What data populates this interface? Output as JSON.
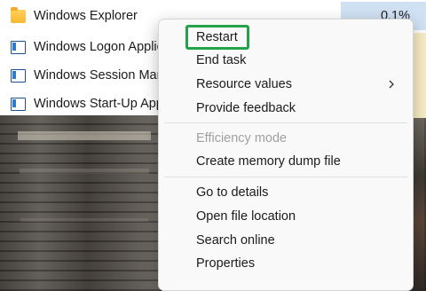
{
  "processes": [
    {
      "name": "Windows Explorer",
      "icon": "folder-icon",
      "cpu": "0.1%"
    },
    {
      "name": "Windows Logon Applic",
      "icon": "window-icon"
    },
    {
      "name": "Windows Session Mana",
      "icon": "window-icon"
    },
    {
      "name": "Windows Start-Up App",
      "icon": "window-icon"
    }
  ],
  "context_menu": {
    "items": [
      {
        "label": "Restart",
        "highlighted": true
      },
      {
        "label": "End task"
      },
      {
        "label": "Resource values",
        "submenu": true
      },
      {
        "label": "Provide feedback"
      },
      {
        "label": "Efficiency mode",
        "disabled": true
      },
      {
        "label": "Create memory dump file"
      },
      {
        "label": "Go to details"
      },
      {
        "label": "Open file location"
      },
      {
        "label": "Search online"
      },
      {
        "label": "Properties"
      }
    ]
  },
  "colors": {
    "highlight_border": "#24a24a",
    "cpu_selected": "#cfe1f3",
    "cpu_heat": "#f9edc5"
  }
}
